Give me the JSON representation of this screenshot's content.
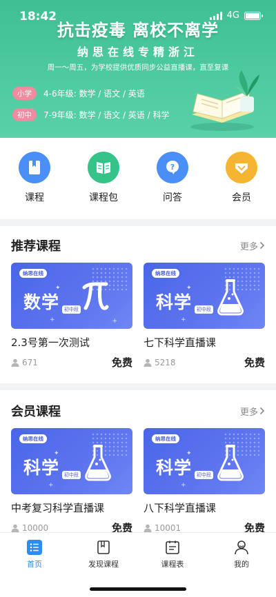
{
  "status": {
    "time": "18:42",
    "network": "4G"
  },
  "banner": {
    "title": "抗击疫毒 离校不离学",
    "subtitle": "纳思在线专精浙江",
    "desc": "周一～周五，为学校提供优质同步公益直播课，直至复课",
    "rows": [
      {
        "tag": "小学",
        "text": "4-6年级: 数学 / 语文 / 英语"
      },
      {
        "tag": "初中",
        "text": "7-9年级: 数学 / 语文 / 英语 / 科学"
      }
    ]
  },
  "quick_nav": [
    {
      "label": "课程",
      "icon": "bookmark-book-icon",
      "color": "#4a8ff7"
    },
    {
      "label": "课程包",
      "icon": "open-book-icon",
      "color": "#35c38a"
    },
    {
      "label": "问答",
      "icon": "question-bubble-icon",
      "color": "#4a8ff7"
    },
    {
      "label": "会员",
      "icon": "vip-crown-icon",
      "color": "#f5b533"
    }
  ],
  "recommended": {
    "title": "推荐课程",
    "more": "更多",
    "courses": [
      {
        "brand": "纳思在线",
        "subject": "数学",
        "level": "初中段",
        "icon": "pi-icon",
        "title": "2.3号第一次测试",
        "learners": "671",
        "price": "免费"
      },
      {
        "brand": "纳思在线",
        "subject": "科学",
        "level": "初中段",
        "icon": "flask-icon",
        "title": "七下科学直播课",
        "learners": "5218",
        "price": "免费"
      }
    ]
  },
  "member": {
    "title": "会员课程",
    "more": "更多",
    "courses": [
      {
        "brand": "纳思在线",
        "subject": "科学",
        "level": "初中段",
        "icon": "flask-icon",
        "title": "中考复习科学直播课",
        "learners": "10000",
        "price": "免费"
      },
      {
        "brand": "纳思在线",
        "subject": "科学",
        "level": "初中段",
        "icon": "flask-icon",
        "title": "八下科学直播课",
        "learners": "10001",
        "price": "免费"
      }
    ]
  },
  "tabbar": [
    {
      "label": "首页",
      "icon": "home-list-icon",
      "active": true
    },
    {
      "label": "发现课程",
      "icon": "discover-book-icon",
      "active": false
    },
    {
      "label": "课程表",
      "icon": "schedule-icon",
      "active": false
    },
    {
      "label": "我的",
      "icon": "profile-icon",
      "active": false
    }
  ],
  "colors": {
    "banner_green": "#4ecaa0",
    "card_blue": "#5b73ee",
    "tab_active": "#2f8bf0",
    "tag_pink": "#f28aa0"
  }
}
